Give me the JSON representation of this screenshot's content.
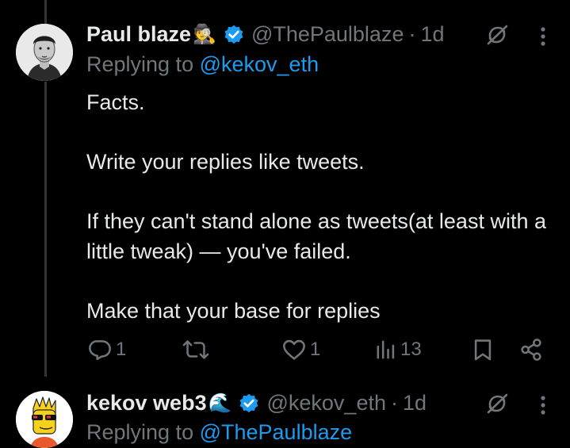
{
  "tweet1": {
    "name": "Paul blaze",
    "emoji": "🕵️",
    "handle": "@ThePaulblaze",
    "separator": "·",
    "time": "1d",
    "replying_prefix": "Replying to ",
    "replying_to": "@kekov_eth",
    "body": [
      "Facts.",
      "",
      "Write your replies like tweets.",
      "",
      "If they can't stand alone as tweets(at least with a little tweak) — you've failed.",
      "",
      "Make that your base for replies"
    ],
    "actions": {
      "replies": "1",
      "reposts": "",
      "likes": "1",
      "views": "13"
    }
  },
  "tweet2": {
    "name": "kekov web3",
    "emoji": "🌊",
    "handle": "@kekov_eth",
    "separator": "·",
    "time": "1d",
    "replying_prefix": "Replying to ",
    "replying_to": "@ThePaulblaze"
  },
  "colors": {
    "background": "#000000",
    "text": "#e7e9ea",
    "muted": "#71767b",
    "accent": "#1d9bf0",
    "verified": "#1d9bf0"
  },
  "icons": [
    "grok-icon",
    "more-icon",
    "reply-icon",
    "repost-icon",
    "like-icon",
    "views-icon",
    "bookmark-icon",
    "share-icon",
    "verified-badge-icon"
  ]
}
